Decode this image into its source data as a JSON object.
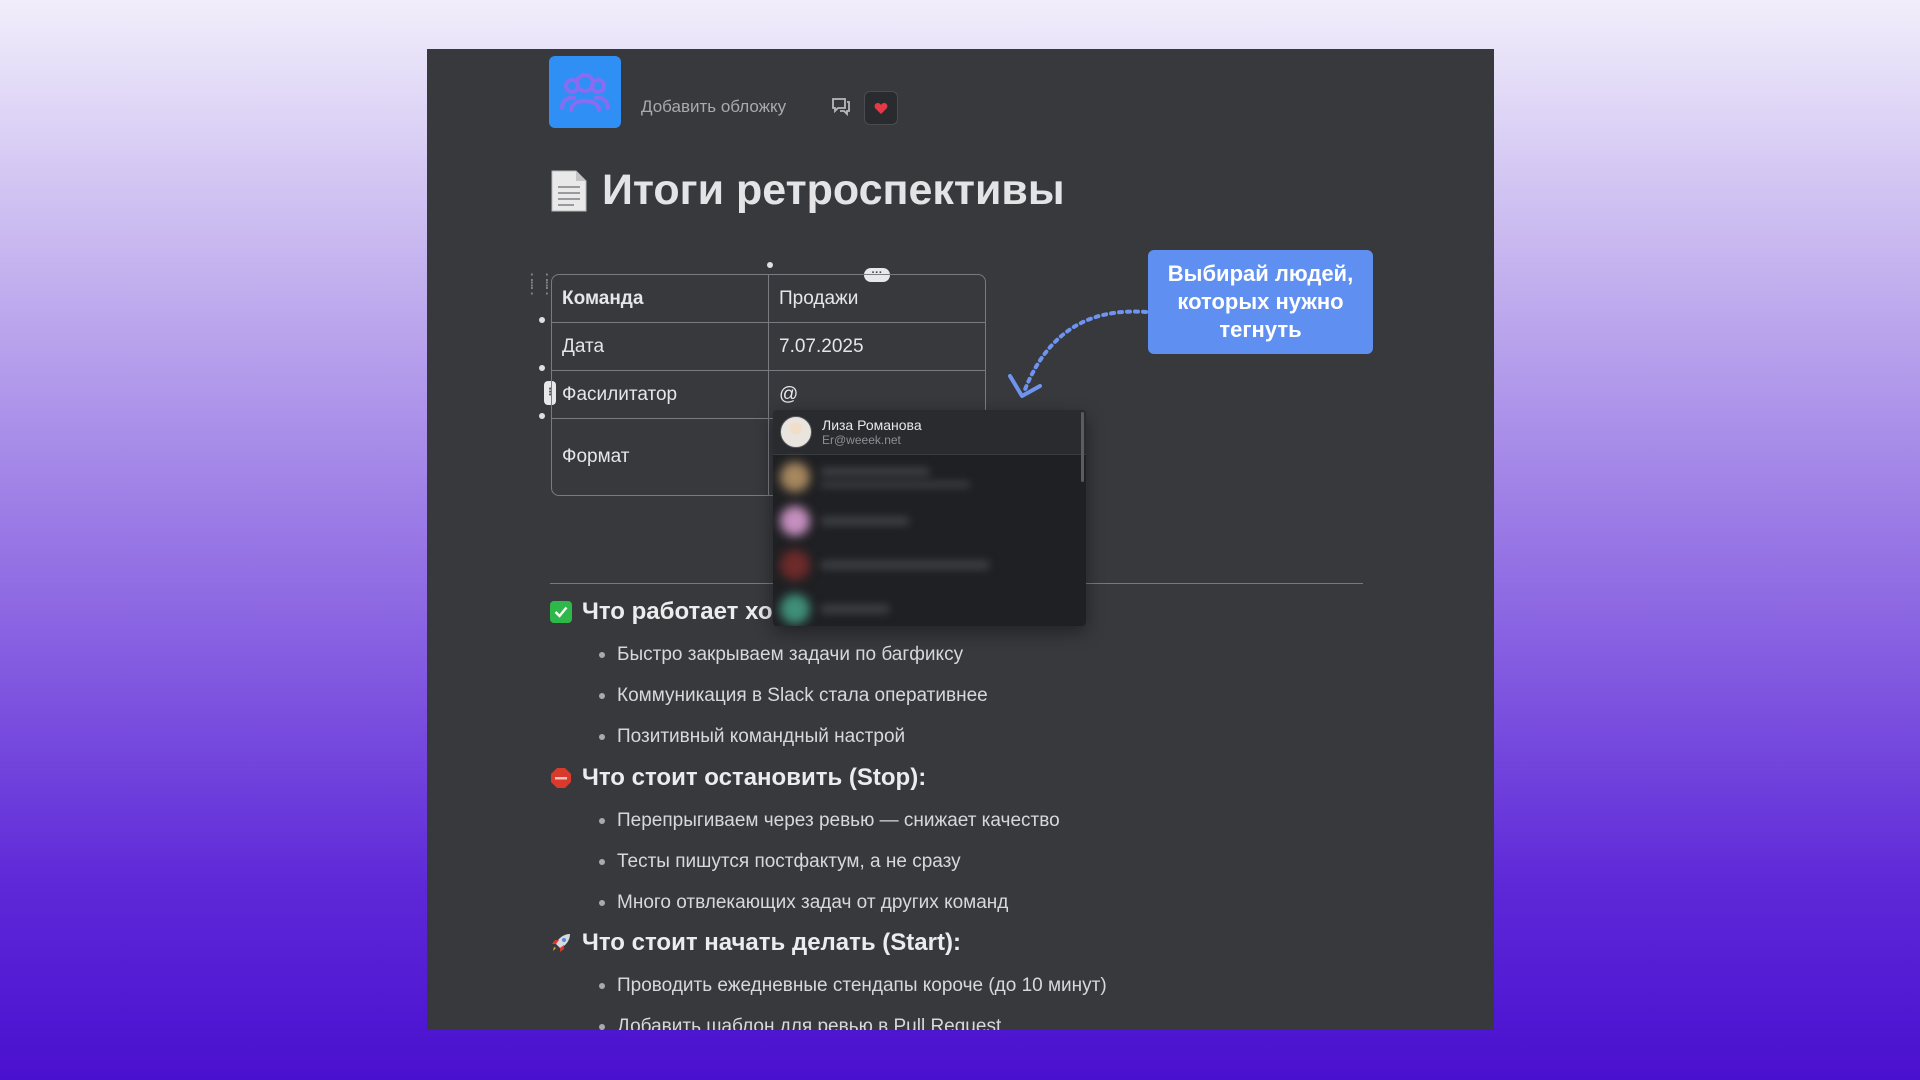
{
  "page": {
    "cover_link": "Добавить обложку",
    "title": "Итоги ретроспективы",
    "title_icon": "page-icon",
    "page_icon": "people-icon"
  },
  "colors": {
    "page_icon_bg": "#2f8ff5",
    "callout_bg": "#5f8ff0",
    "document_bg": "#38393d"
  },
  "table": {
    "rows": [
      {
        "label": "Команда",
        "value": "Продажи"
      },
      {
        "label": "Дата",
        "value": "7.07.2025"
      },
      {
        "label": "Фасилитатор",
        "value": "@"
      },
      {
        "label": "Формат",
        "value": ""
      }
    ]
  },
  "mention": {
    "user_name": "Лиза Романова",
    "user_email": "Er@weeek.net"
  },
  "callout": {
    "line1": "Выбирай людей,",
    "line2": "которых нужно",
    "line3": "тегнуть"
  },
  "sections": {
    "good": {
      "heading": "Что работает хо",
      "items": [
        "Быстро закрываем задачи по багфиксу",
        "Коммуникация в Slack стала оперативнее",
        "Позитивный командный настрой"
      ]
    },
    "stop": {
      "heading": "Что стоит остановить (Stop):",
      "items": [
        "Перепрыгиваем через ревью — снижает качество",
        "Тесты пишутся постфактум, а не сразу",
        "Много отвлекающих задач от других команд"
      ]
    },
    "start": {
      "heading": "Что стоит начать делать (Start):",
      "items": [
        "Проводить ежедневные стендапы короче (до 10 минут)",
        "Добавить шаблон для ревью в Pull Request"
      ]
    }
  }
}
